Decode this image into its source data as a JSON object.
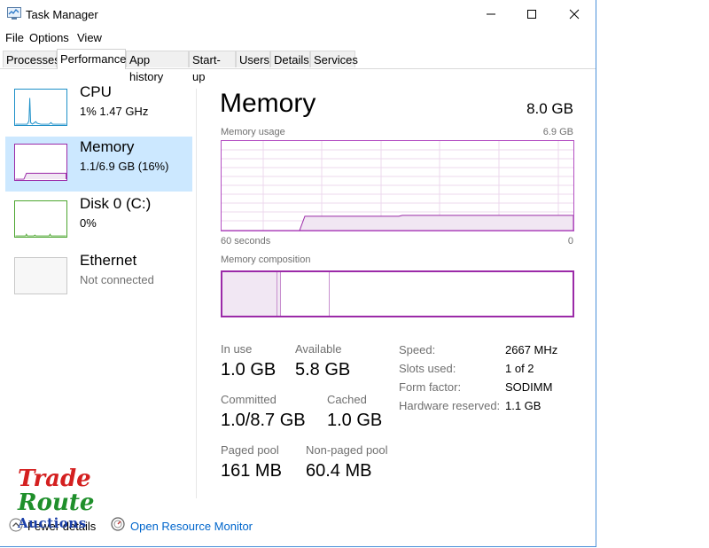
{
  "window": {
    "title": "Task Manager"
  },
  "menu": [
    "File",
    "Options",
    "View"
  ],
  "tabs": [
    "Processes",
    "Performance",
    "App history",
    "Start-up",
    "Users",
    "Details",
    "Services"
  ],
  "sidebar": [
    {
      "title": "CPU",
      "sub": "1%  1.47 GHz"
    },
    {
      "title": "Memory",
      "sub": "1.1/6.9 GB (16%)"
    },
    {
      "title": "Disk 0 (C:)",
      "sub": "0%"
    },
    {
      "title": "Ethernet",
      "sub": "Not connected"
    }
  ],
  "memory": {
    "title": "Memory",
    "total": "8.0 GB",
    "usage_label": "Memory usage",
    "usage_max": "6.9 GB",
    "x_left": "60 seconds",
    "x_right": "0",
    "composition_label": "Memory composition",
    "usage_level": 0.16
  },
  "stats": {
    "in_use_label": "In use",
    "in_use": "1.0 GB",
    "available_label": "Available",
    "available": "5.8 GB",
    "committed_label": "Committed",
    "committed": "1.0/8.7 GB",
    "cached_label": "Cached",
    "cached": "1.0 GB",
    "paged_label": "Paged pool",
    "paged": "161 MB",
    "nonpaged_label": "Non-paged pool",
    "nonpaged": "60.4 MB"
  },
  "specs": [
    {
      "label": "Speed:",
      "value": "2667 MHz"
    },
    {
      "label": "Slots used:",
      "value": "1 of 2"
    },
    {
      "label": "Form factor:",
      "value": "SODIMM"
    },
    {
      "label": "Hardware reserved:",
      "value": "1.1 GB"
    }
  ],
  "footer": {
    "fewer_details": "Fewer details",
    "resource_monitor": "Open Resource Monitor"
  },
  "watermark": {
    "line1": "Trade",
    "line2": "Route",
    "line3": "Auctions"
  },
  "colors": {
    "accent": "#9b2aa8",
    "selected": "#cce8ff",
    "cpu": "#1e90c8",
    "disk": "#4da630",
    "link": "#0066cc"
  }
}
